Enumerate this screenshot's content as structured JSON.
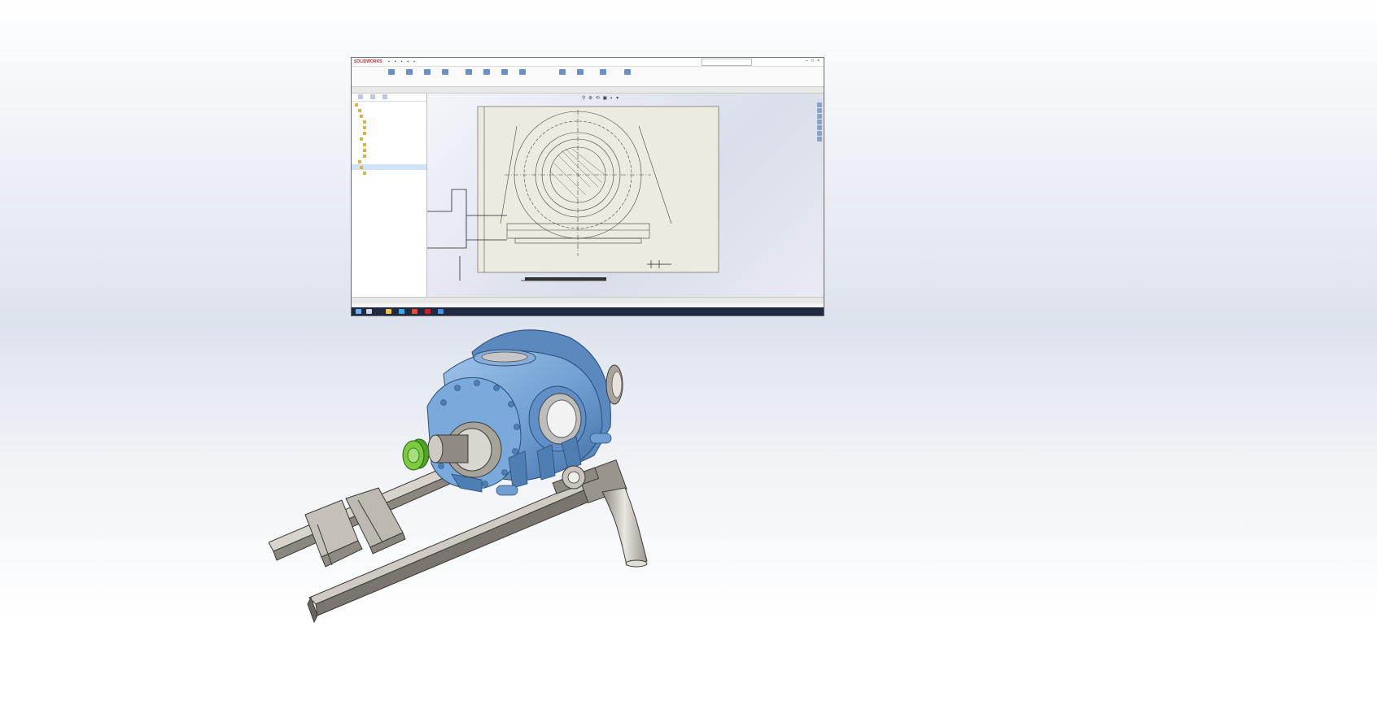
{
  "window": {
    "app_name": "SOLIDWORKS",
    "doc_title": "",
    "search_placeholder": ""
  },
  "ribbon": {
    "buttons": [
      "",
      "",
      "",
      "",
      "",
      "",
      "",
      "",
      "",
      "",
      "",
      ""
    ]
  },
  "command_tabs": [
    "",
    "",
    "",
    "",
    "",
    "",
    "",
    "",
    "",
    "",
    ""
  ],
  "feature_tree": {
    "nodes": [
      "",
      "",
      "",
      "",
      "",
      "",
      "",
      "",
      "",
      "",
      "",
      "",
      ""
    ]
  },
  "drawing": {
    "view_label": "",
    "scale_note": ""
  },
  "bottom_tabs": [
    "",
    "",
    "",
    ""
  ],
  "status": {
    "left": "",
    "right": ""
  },
  "taskbar": {
    "time": "",
    "date": ""
  },
  "colors": {
    "vessel": "#6f9fd2",
    "vessel_dark": "#4d7fb5",
    "frame": "#a9a39a",
    "coupling": "#7ccc3e",
    "pipe": "#c9c4bc"
  }
}
